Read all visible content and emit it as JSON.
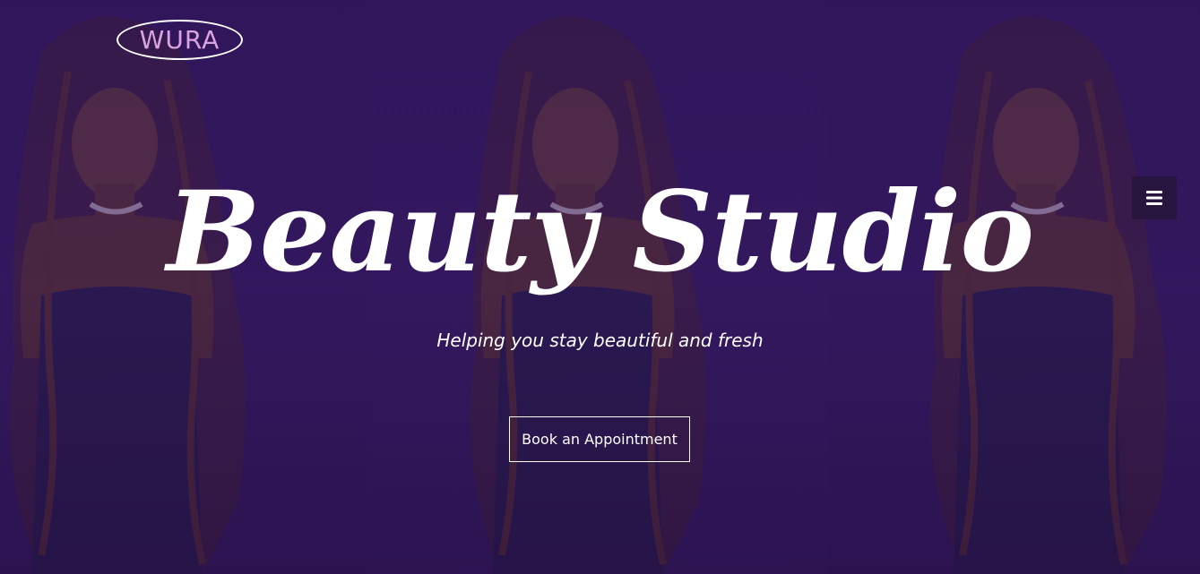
{
  "brand": {
    "logo_text": "WURA"
  },
  "nav": {
    "menu_icon": "hamburger-menu-icon"
  },
  "hero": {
    "title": "Beauty Studio",
    "subtitle": "Helping you stay beautiful and fresh",
    "cta_label": "Book an Appointment",
    "background_image": "portrait-photo"
  },
  "colors": {
    "background": "#2b1250",
    "overlay_purple": "#341a5e",
    "logo_text": "#d9a3e0",
    "text": "#ffffff"
  }
}
